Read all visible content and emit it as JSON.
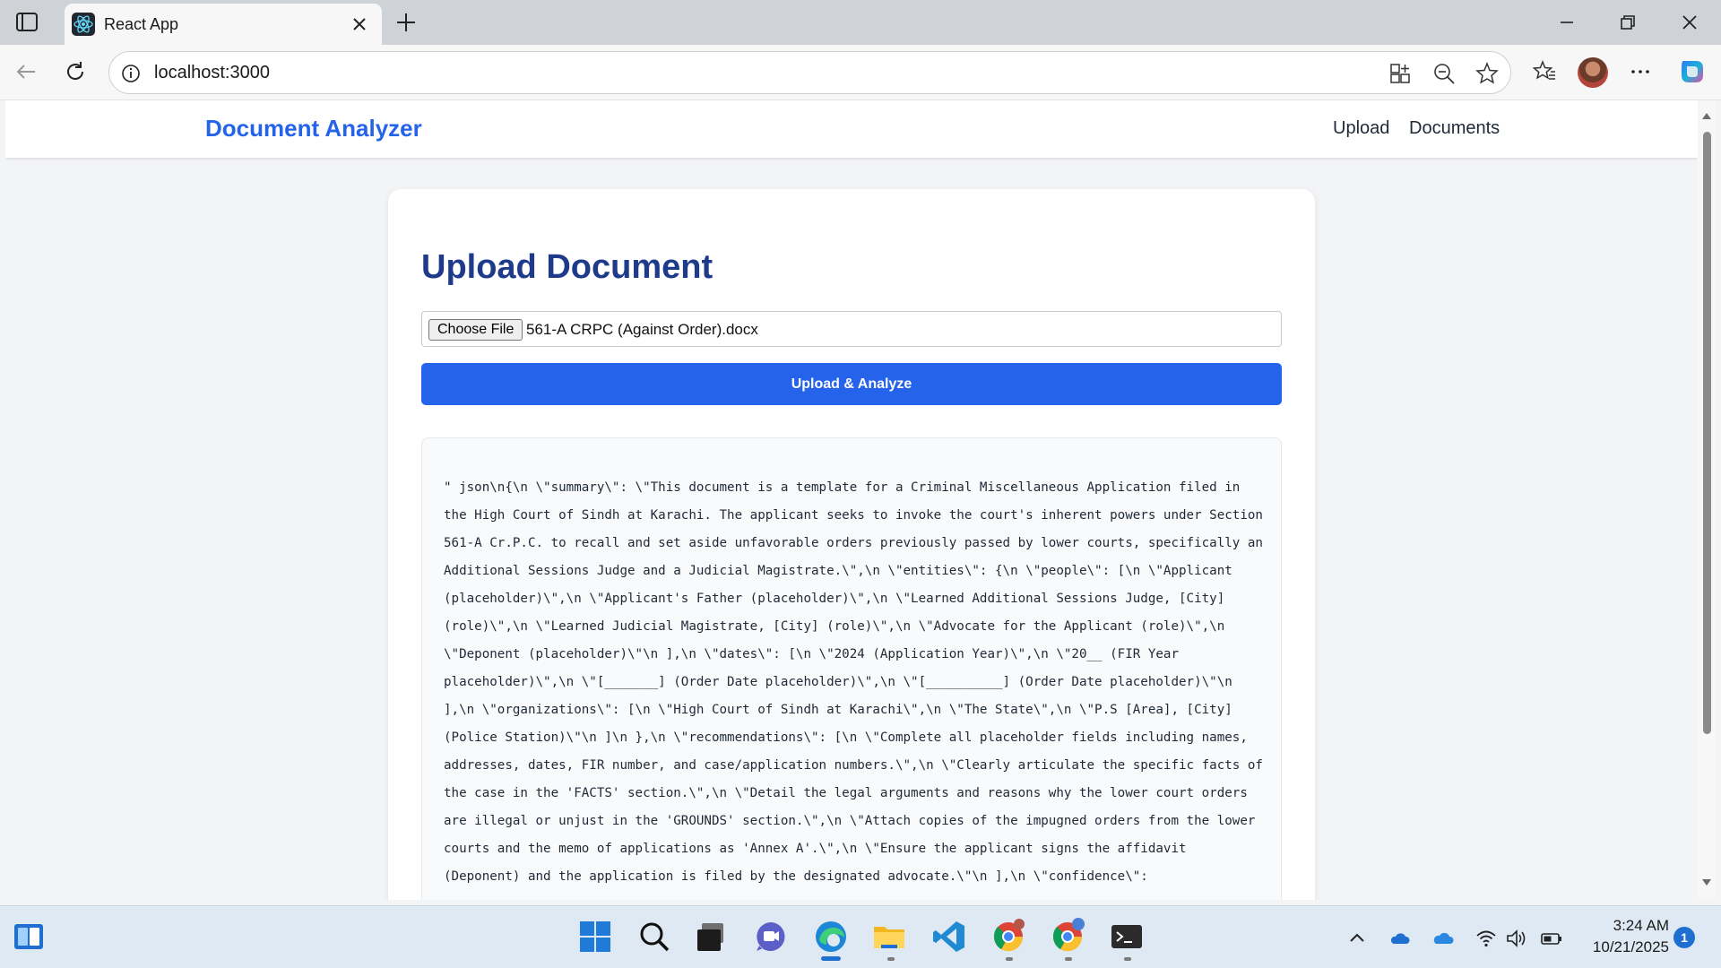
{
  "browser": {
    "tab_title": "React App",
    "url": "localhost:3000"
  },
  "app": {
    "brand": "Document Analyzer",
    "nav": [
      "Upload",
      "Documents"
    ]
  },
  "upload": {
    "heading": "Upload Document",
    "choose_file_label": "Choose File",
    "selected_file": "561-A CRPC (Against Order).docx",
    "submit_label": "Upload & Analyze"
  },
  "result": {
    "raw_text": "\" json\\n{\\n \\\"summary\\\": \\\"This document is a template for a Criminal Miscellaneous Application filed in the High Court of Sindh at Karachi. The applicant seeks to invoke the court's inherent powers under Section 561-A Cr.P.C. to recall and set aside unfavorable orders previously passed by lower courts, specifically an Additional Sessions Judge and a Judicial Magistrate.\\\",\\n \\\"entities\\\": {\\n \\\"people\\\": [\\n \\\"Applicant (placeholder)\\\",\\n \\\"Applicant's Father (placeholder)\\\",\\n \\\"Learned Additional Sessions Judge, [City] (role)\\\",\\n \\\"Learned Judicial Magistrate, [City] (role)\\\",\\n \\\"Advocate for the Applicant (role)\\\",\\n \\\"Deponent (placeholder)\\\"\\n ],\\n \\\"dates\\\": [\\n \\\"2024 (Application Year)\\\",\\n \\\"20__ (FIR Year placeholder)\\\",\\n \\\"[_______] (Order Date placeholder)\\\",\\n \\\"[__________] (Order Date placeholder)\\\"\\n ],\\n \\\"organizations\\\": [\\n \\\"High Court of Sindh at Karachi\\\",\\n \\\"The State\\\",\\n \\\"P.S [Area], [City] (Police Station)\\\"\\n ]\\n },\\n \\\"recommendations\\\": [\\n \\\"Complete all placeholder fields including names, addresses, dates, FIR number, and case/application numbers.\\\",\\n \\\"Clearly articulate the specific facts of the case in the 'FACTS' section.\\\",\\n \\\"Detail the legal arguments and reasons why the lower court orders are illegal or unjust in the 'GROUNDS' section.\\\",\\n \\\"Attach copies of the impugned orders from the lower courts and the memo of applications as 'Annex A'.\\\",\\n \\\"Ensure the applicant signs the affidavit (Deponent) and the application is filed by the designated advocate.\\\"\\n ],\\n \\\"confidence\\\":"
  },
  "taskbar": {
    "time": "3:24 AM",
    "date": "10/21/2025",
    "notification_count": "1"
  },
  "colors": {
    "brand_blue": "#2563eb",
    "heading_navy": "#1e3a8a"
  }
}
